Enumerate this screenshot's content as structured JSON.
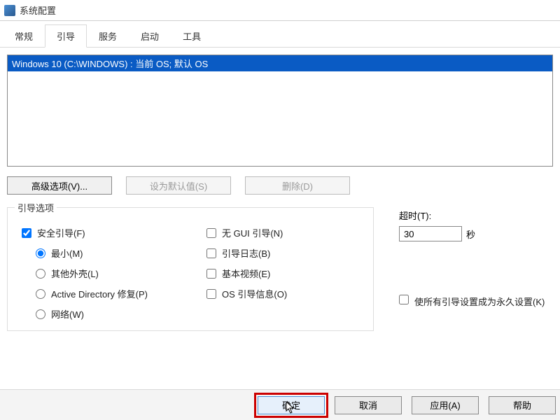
{
  "window": {
    "title": "系统配置"
  },
  "tabs": {
    "general": "常规",
    "boot": "引导",
    "services": "服务",
    "startup": "启动",
    "tools": "工具",
    "active": "boot"
  },
  "oslist": {
    "items": [
      "Windows 10 (C:\\WINDOWS) : 当前 OS; 默认 OS"
    ]
  },
  "buttons": {
    "advanced": "高级选项(V)...",
    "setdefault": "设为默认值(S)",
    "delete": "删除(D)"
  },
  "bootopts": {
    "legend": "引导选项",
    "safeboot": "安全引导(F)",
    "radio_min": "最小(M)",
    "radio_altshell": "其他外壳(L)",
    "radio_ad": "Active Directory 修复(P)",
    "radio_network": "网络(W)",
    "no_gui": "无 GUI 引导(N)",
    "bootlog": "引导日志(B)",
    "basevideo": "基本视频(E)",
    "osinfo": "OS 引导信息(O)"
  },
  "timeout": {
    "label": "超时(T):",
    "value": "30",
    "seconds": "秒"
  },
  "permanent": {
    "label": "使所有引导设置成为永久设置(K)"
  },
  "footer": {
    "ok": "确定",
    "cancel": "取消",
    "apply": "应用(A)",
    "help": "帮助"
  }
}
